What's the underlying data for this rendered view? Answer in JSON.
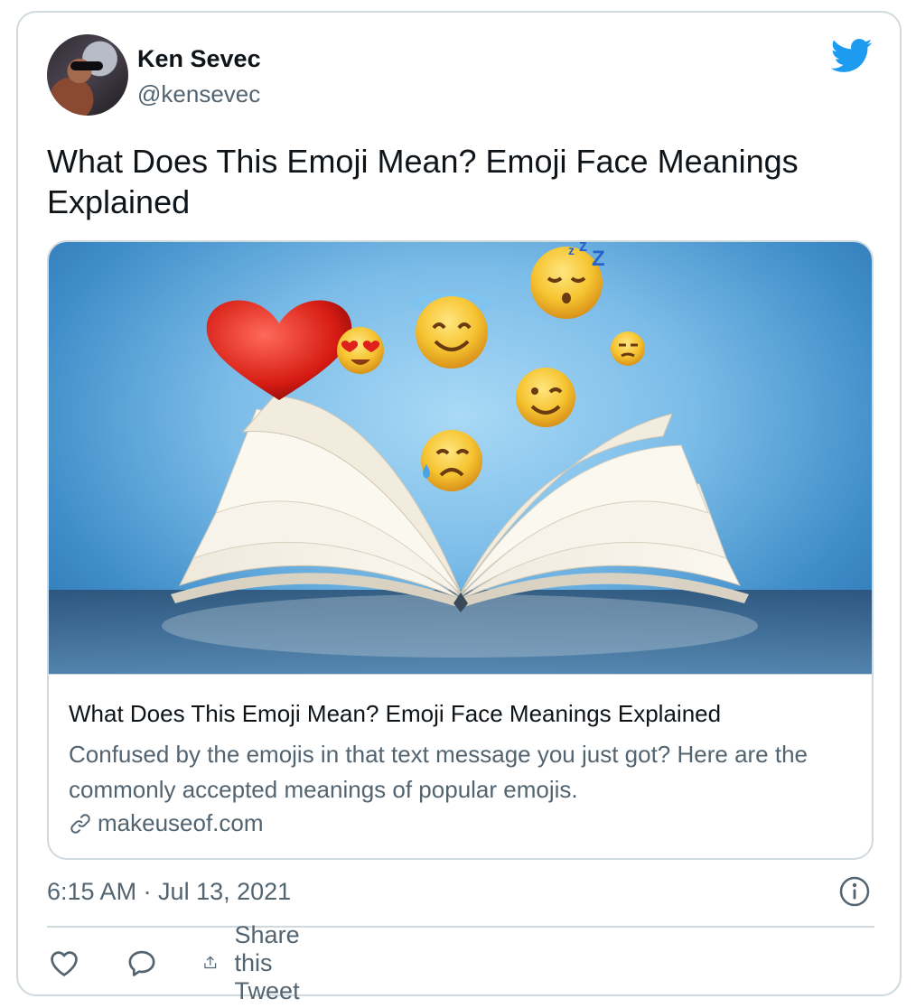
{
  "author": {
    "name": "Ken Sevec",
    "handle": "@kensevec"
  },
  "tweet": {
    "text": "What Does This Emoji Mean? Emoji Face Meanings Explained",
    "timestamp": "6:15 AM · Jul 13, 2021"
  },
  "card": {
    "title": "What Does This Emoji Mean? Emoji Face Meanings Explained",
    "description": "Confused by the emojis in that text message you just got? Here are the commonly accepted meanings of popular emojis.",
    "domain": "makeuseof.com"
  },
  "actions": {
    "like_icon": "heart-icon",
    "reply_icon": "reply-icon",
    "share_icon": "share-icon",
    "share_label": "Share this Tweet"
  },
  "colors": {
    "brand": "#1d9bf0",
    "text": "#0f1419",
    "secondary": "#536471",
    "border": "#cfd9de"
  }
}
